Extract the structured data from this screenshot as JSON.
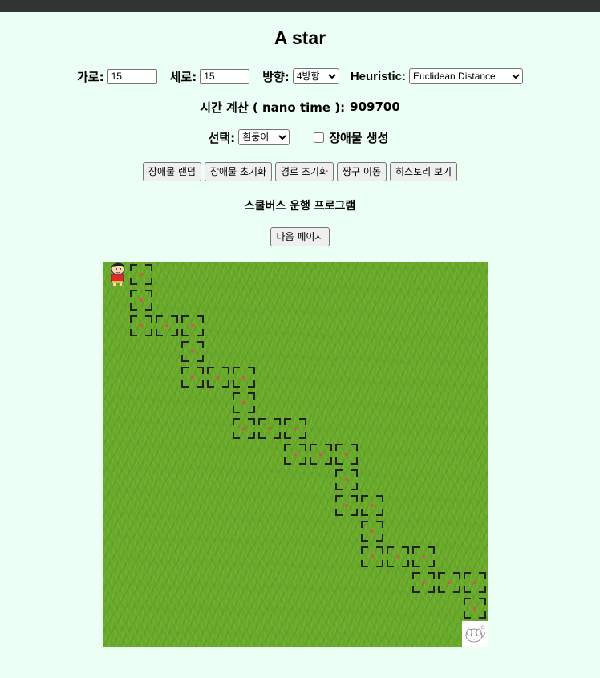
{
  "page": {
    "title": "A star"
  },
  "controls": {
    "width_label": "가로:",
    "width_value": "15",
    "height_label": "세로:",
    "height_value": "15",
    "direction_label": "방향:",
    "direction_value": "4방향",
    "heuristic_label": "Heuristic:",
    "heuristic_value": "Euclidean Distance"
  },
  "timing": {
    "label": "시간 계산 ( nano time ):",
    "value": "909700"
  },
  "selection": {
    "label": "선택:",
    "value": "흰둥이",
    "obstacle_label": "장애물 생성",
    "obstacle_checked": false
  },
  "buttons": {
    "random_obstacles": "장애물 랜덤",
    "reset_obstacles": "장애물 초기화",
    "reset_path": "경로 초기화",
    "move_jjanggu": "짱구 이동",
    "view_history": "히스토리 보기"
  },
  "program": {
    "title": "스쿨버스 운행 프로그램",
    "next_page": "다음 페이지"
  },
  "grid": {
    "cols": 15,
    "rows": 15,
    "start": [
      0,
      0
    ],
    "goal": [
      14,
      14
    ],
    "start_icon": "jjanggu-character-icon",
    "goal_icon": "white-dog-character-icon",
    "path": [
      [
        1,
        0
      ],
      [
        1,
        1
      ],
      [
        1,
        2
      ],
      [
        2,
        2
      ],
      [
        3,
        2
      ],
      [
        3,
        3
      ],
      [
        3,
        4
      ],
      [
        4,
        4
      ],
      [
        5,
        4
      ],
      [
        5,
        5
      ],
      [
        5,
        6
      ],
      [
        6,
        6
      ],
      [
        7,
        6
      ],
      [
        7,
        7
      ],
      [
        8,
        7
      ],
      [
        9,
        7
      ],
      [
        9,
        8
      ],
      [
        9,
        9
      ],
      [
        10,
        9
      ],
      [
        10,
        10
      ],
      [
        10,
        11
      ],
      [
        11,
        11
      ],
      [
        12,
        11
      ],
      [
        12,
        12
      ],
      [
        13,
        12
      ],
      [
        14,
        12
      ],
      [
        14,
        13
      ]
    ],
    "grass_color": "#66a828",
    "path_corner_color": "#222222",
    "path_dot_color": "#e0504a"
  }
}
